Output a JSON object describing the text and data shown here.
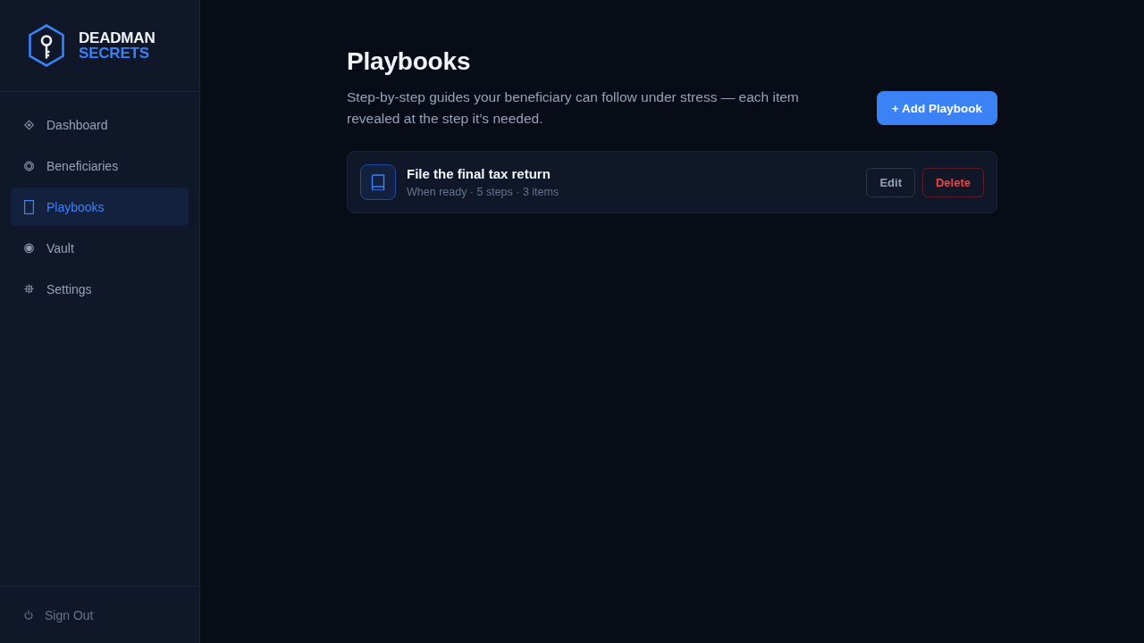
{
  "sidebar": {
    "logo": {
      "line_1": "DEADMAN",
      "line_2": "SECRETS"
    },
    "items": [
      {
        "label": "Dashboard",
        "selected": false
      },
      {
        "label": "Beneficiaries",
        "selected": false
      },
      {
        "label": "Playbooks",
        "selected": true
      },
      {
        "label": "Vault",
        "selected": false
      },
      {
        "label": "Settings",
        "selected": false
      }
    ],
    "sign_out": {
      "label": "Sign Out"
    }
  },
  "main": {
    "title": "Playbooks",
    "description": "Step-by-step guides your beneficiary can follow under stress — each item revealed at the step it’s needed.",
    "add_button": "+ Add Playbook",
    "playbooks": [
      {
        "title": "File the final tax return",
        "meta": "When ready · 5 steps · 3 items",
        "actions": [
          {
            "label": "Edit",
            "kind": "neutral"
          },
          {
            "label": "Delete",
            "kind": "danger"
          }
        ]
      }
    ]
  }
}
